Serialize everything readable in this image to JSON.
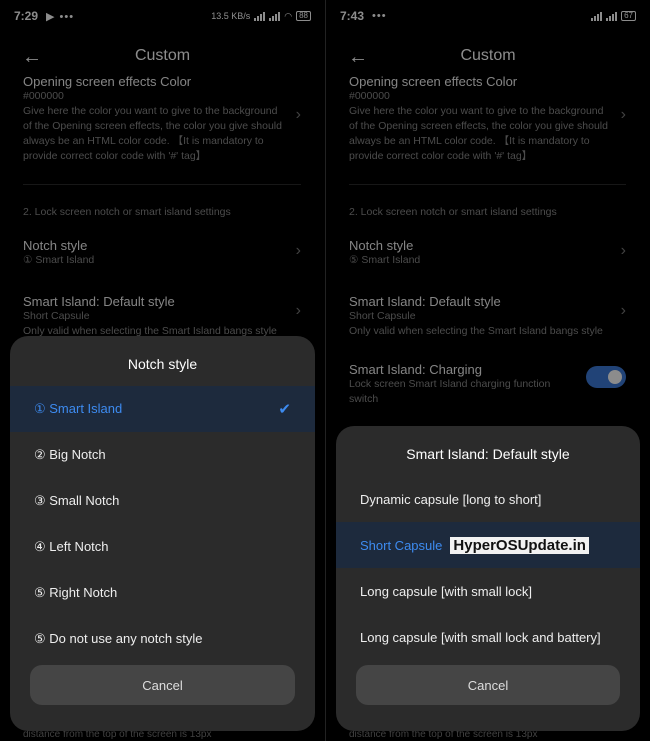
{
  "left": {
    "status": {
      "time": "7:29",
      "extra": "▶ •••",
      "speed": "13.5 KB/s",
      "battery": "88"
    },
    "header": {
      "title": "Custom"
    },
    "items": [
      {
        "title": "Opening screen effects Color",
        "value": "#000000",
        "desc": "Give here the color you want to give to the background of the Opening screen effects, the color you give should always be an HTML color code. 【It is mandatory to provide correct color code with '#' tag】"
      },
      {
        "title": "Notch style",
        "value": "① Smart Island"
      },
      {
        "title": "Smart Island: Default style",
        "value": "Short Capsule",
        "desc": "Only valid when selecting the Smart Island bangs style"
      }
    ],
    "section": "2. Lock screen notch or smart island settings",
    "footer": "distance from the top of the screen is 13px",
    "sheet": {
      "title": "Notch style",
      "options": [
        "① Smart Island",
        "② Big Notch",
        "③ Small Notch",
        "④ Left Notch",
        "⑤ Right Notch",
        "⑤ Do not use any notch style"
      ],
      "selected": 0,
      "cancel": "Cancel"
    }
  },
  "right": {
    "status": {
      "time": "7:43",
      "extra": "•••",
      "battery": "67"
    },
    "header": {
      "title": "Custom"
    },
    "items": [
      {
        "title": "Opening screen effects Color",
        "value": "#000000",
        "desc": "Give here the color you want to give to the background of the Opening screen effects, the color you give should always be an HTML color code. 【It is mandatory to provide correct color code with '#' tag】"
      },
      {
        "title": "Notch style",
        "value": "⑤ Smart Island"
      },
      {
        "title": "Smart Island: Default style",
        "value": "Short Capsule",
        "desc": "Only valid when selecting the Smart Island bangs style"
      },
      {
        "title": "Smart Island: Charging",
        "desc": "Lock screen Smart Island charging function switch"
      }
    ],
    "section": "2. Lock screen notch or smart island settings",
    "footer": "distance from the top of the screen is 13px",
    "sheet": {
      "title": "Smart Island: Default style",
      "options": [
        "Dynamic capsule [long to short]",
        "Short Capsule",
        "Long capsule [with small lock]",
        "Long capsule [with small lock and battery]"
      ],
      "selected": 1,
      "watermark": "HyperOSUpdate.in",
      "cancel": "Cancel"
    }
  },
  "colors": {
    "accent": "#3d8bf0",
    "sheet_bg": "#2b2b2b",
    "selected_bg": "#1d2a3d"
  }
}
